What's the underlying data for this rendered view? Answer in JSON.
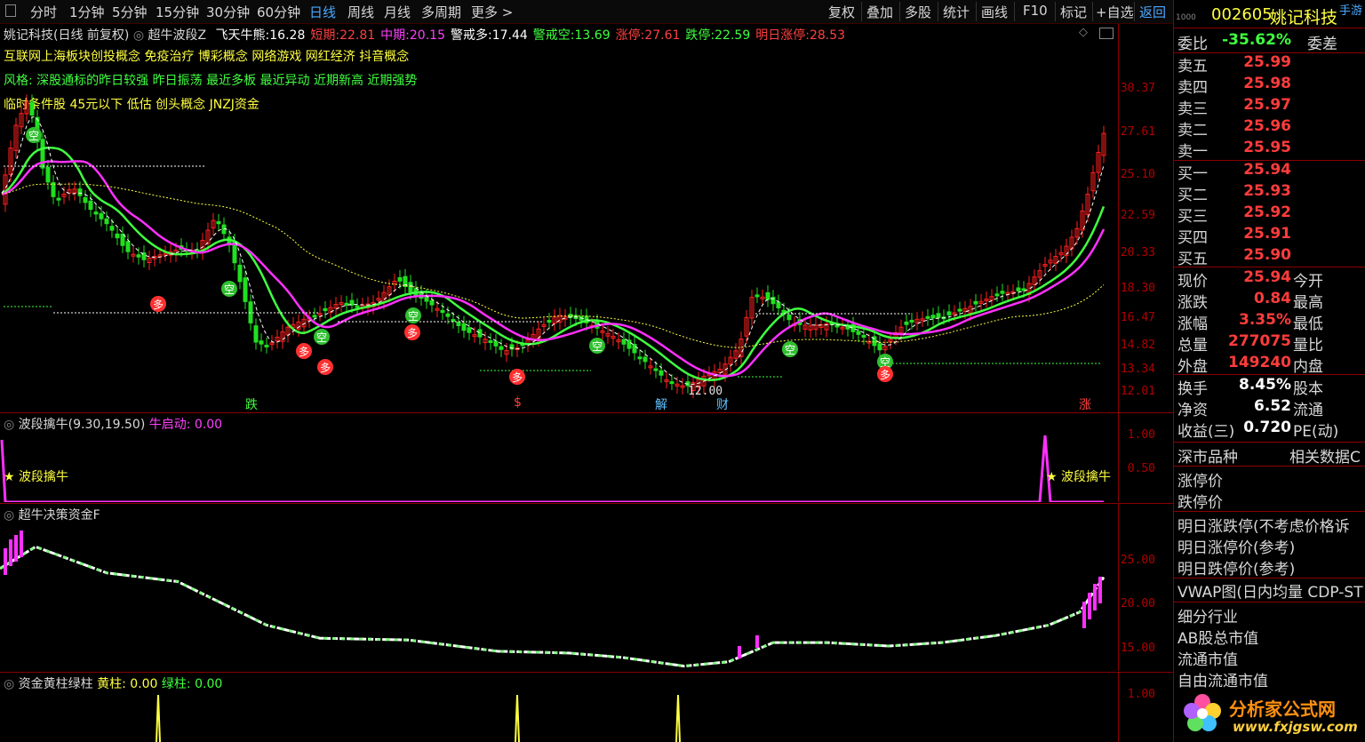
{
  "toolbar": {
    "items": [
      "分时",
      "1分钟",
      "5分钟",
      "15分钟",
      "30分钟",
      "60分钟",
      "日线",
      "周线",
      "月线",
      "多周期",
      "更多 >"
    ],
    "right_items": [
      "复权",
      "叠加",
      "多股",
      "统计",
      "画线",
      "F10",
      "标记",
      "+自选",
      "返回"
    ],
    "active": "日线"
  },
  "main_pane": {
    "stock_title": "姚记科技(日线 前复权)",
    "indicator": "超牛波段Z",
    "params": [
      {
        "label": "飞天牛熊:",
        "value": "16.28",
        "color": "#ffffff"
      },
      {
        "label": "短期:",
        "value": "22.81",
        "color": "#ff4040"
      },
      {
        "label": "中期:",
        "value": "20.15",
        "color": "#ff40ff"
      },
      {
        "label": "警戒多:",
        "value": "17.44",
        "color": "#ffffff"
      },
      {
        "label": "警戒空:",
        "value": "13.69",
        "color": "#40ff40"
      },
      {
        "label": "涨停:",
        "value": "27.61",
        "color": "#ff4040"
      },
      {
        "label": "跌停:",
        "value": "22.59",
        "color": "#40ff40"
      },
      {
        "label": "明日涨停:",
        "value": "28.53",
        "color": "#ff4040"
      }
    ],
    "concept_line1": "互联网上海板块创投概念 免疫治疗 博彩概念 网络游戏 网红经济 抖音概念",
    "concept_line2": "风格: 深股通标的昨日较强 昨日振荡 最近多板 最近异动 近期新高 近期强势",
    "concept_line3": "临时条件股 45元以下 低估 创头概念 JNZJ资金",
    "price_ticks": [
      "30.37",
      "27.61",
      "25.10",
      "22.59",
      "20.33",
      "18.30",
      "16.47",
      "14.82",
      "13.34",
      "12.01"
    ],
    "low_label": "12.00",
    "bottom_markers": [
      {
        "text": "跌",
        "color": "#40ff40"
      },
      {
        "text": "$",
        "color": "#ff4040"
      },
      {
        "text": "解",
        "color": "#60c0ff"
      },
      {
        "text": "财",
        "color": "#60c0ff"
      },
      {
        "text": "涨",
        "color": "#ff4040"
      }
    ],
    "signal_kong": "空",
    "signal_duo": "多"
  },
  "pane2": {
    "title": "波段擒牛(9.30,19.50)",
    "param_label": "牛启动:",
    "param_value": "0.00",
    "ticks": [
      "1.00",
      "0.50"
    ],
    "signal_text": "★ 波段擒牛"
  },
  "pane3": {
    "title": "超牛决策资金F",
    "ticks": [
      "25.00",
      "20.00",
      "15.00"
    ]
  },
  "pane4": {
    "title": "资金黄柱绿柱",
    "yellow_label": "黄柱:",
    "yellow_value": "0.00",
    "green_label": "绿柱:",
    "green_value": "0.00",
    "ticks": [
      "1.00"
    ]
  },
  "right_panel": {
    "code": "002605",
    "name": "姚记科技",
    "corner": "手游",
    "weibi_label": "委比",
    "weibi_value": "-35.62%",
    "weicha_label": "委差",
    "asks": [
      {
        "label": "卖五",
        "price": "25.99"
      },
      {
        "label": "卖四",
        "price": "25.98"
      },
      {
        "label": "卖三",
        "price": "25.97"
      },
      {
        "label": "卖二",
        "price": "25.96"
      },
      {
        "label": "卖一",
        "price": "25.95"
      }
    ],
    "bids": [
      {
        "label": "买一",
        "price": "25.94"
      },
      {
        "label": "买二",
        "price": "25.93"
      },
      {
        "label": "买三",
        "price": "25.92"
      },
      {
        "label": "买四",
        "price": "25.91"
      },
      {
        "label": "买五",
        "price": "25.90"
      }
    ],
    "stats": [
      {
        "label": "现价",
        "value": "25.94",
        "label2": "今开"
      },
      {
        "label": "涨跌",
        "value": "0.84",
        "label2": "最高"
      },
      {
        "label": "涨幅",
        "value": "3.35%",
        "label2": "最低"
      },
      {
        "label": "总量",
        "value": "277075",
        "label2": "量比"
      },
      {
        "label": "外盘",
        "value": "149240",
        "label2": "内盘"
      }
    ],
    "stats2": [
      {
        "label": "换手",
        "value": "8.45%",
        "label2": "股本"
      },
      {
        "label": "净资",
        "value": "6.52",
        "label2": "流通"
      },
      {
        "label": "收益(三)",
        "value": "0.720",
        "label2": "PE(动)"
      }
    ],
    "market_label": "深市品种",
    "related_label": "相关数据C",
    "limit_up": "涨停价",
    "limit_down": "跌停价",
    "tomorrow_title": "明日涨跌停(不考虑价格诉",
    "tomorrow_up": "明日涨停价(参考)",
    "tomorrow_down": "明日跌停价(参考)",
    "vwap": "VWAP图(日内均量 CDP-ST",
    "industry": "细分行业",
    "ab_mv": "AB股总市值",
    "float_mv": "流通市值",
    "free_mv": "自由流通市值",
    "watermark_brand": "分析家公式网",
    "watermark_url": "www.fxjgsw.com"
  },
  "colors": {
    "axis": "#8a0000",
    "up": "#ff2020",
    "down": "#20e020",
    "yellow": "#ffff30",
    "magenta": "#ff30ff"
  }
}
